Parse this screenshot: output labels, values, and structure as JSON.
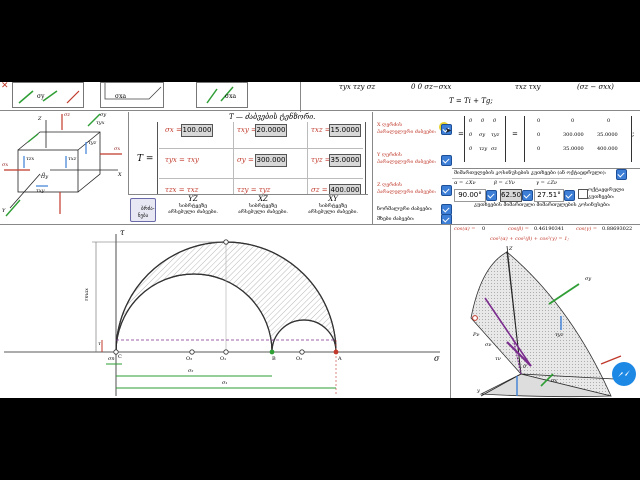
{
  "top_strip": {
    "tensor_row_1": "τyx  τzy  σz",
    "tensor_row_2": "0   0   σz−σxx",
    "tensor_row_3": "τxz  τxy",
    "tensor_row_4": "(σz − σxx)",
    "t_equation": "T = Ti + Tg;"
  },
  "cube_labels": {
    "sy_top": "σy",
    "sigma_bottom_left": "σx",
    "sigma_right": "σx",
    "z": "Z",
    "x": "X",
    "y": "Y",
    "tau_zx": "τzx",
    "tau_xz": "τxz",
    "tau_yz": "τyz",
    "tau_zy": "τzy",
    "tau_xy": "τxy",
    "tau_yx": "τyx",
    "sz": "σz",
    "o": "0"
  },
  "thumbnails": {
    "t1": "σy",
    "t2": "σxa",
    "t3": "σxa"
  },
  "tensor": {
    "title": "T — ძაბვების ტენზორი.",
    "t_symbol": "T =",
    "sx_label": "σx =",
    "sx_value": "100.000",
    "txy_label": "τxy =",
    "txy_value": "20.0000",
    "txz_label": "τxz =",
    "txz_value": "15.0000",
    "tyx_label": "τyx = τxy",
    "sy_label": "σy =",
    "sy_value": "300.000",
    "tyz_label": "τyz =",
    "tyz_value": "35.0000",
    "tzx_label": "τzx = τxz",
    "tzy_label": "τzy = τyz",
    "sz_label": "σz =",
    "sz_value": "400.000"
  },
  "planes": {
    "yz_title": "YZ",
    "yz_sub1": "სიბრტყეზე",
    "yz_sub2": "არსებული ძაბვები.",
    "xz_title": "XZ",
    "xz_sub1": "სიბრტყეზე",
    "xz_sub2": "არსებული ძაბვები.",
    "xy_title": "XY",
    "xy_sub1": "სიბრტყეზე",
    "xy_sub2": "არსებული ძაბვები.",
    "button_label": "ბრძა-\nნება"
  },
  "axis_options": {
    "x_label": "X ღერძის",
    "x_sub": "პარალელური ძაბვები:",
    "y_label": "Y ღერძის",
    "y_sub": "პარალელური ძაბვები:",
    "z_label": "Z ღერძის",
    "z_sub": "პარალელური ძაბვები:",
    "normal": "ნორმალური ძაბვები:",
    "shear": "მხები ძაბვები:"
  },
  "matrix": {
    "eq": "=",
    "r1": [
      "0",
      "0",
      "0"
    ],
    "r2": [
      "0",
      "σy",
      "τyz"
    ],
    "r3": [
      "0",
      "τzy",
      "σz"
    ],
    "m2_r1": [
      "0",
      "0",
      "0"
    ],
    "m2_r2": [
      "0",
      "300.000",
      "35.0000"
    ],
    "m2_r3": [
      "0",
      "35.0000",
      "400.000"
    ],
    "semicolon": ";"
  },
  "orientation": {
    "title": "მიმართულების კოსინუსების კუთხეები (ან ოქტაედრული):",
    "alpha_label": "α = ∠Xν",
    "beta_label": "β = ∠Yν",
    "gamma_label": "γ = ∠Zν",
    "alpha_value": "90.00°",
    "beta_value": "62.50",
    "gamma_value": "27.51°",
    "octa_label": "ოქტაედრული",
    "octa_sub": "კუთხეები:",
    "cos_title": "კუთხეების მიმართული მიმართულების კოსინუსები:",
    "cos_a_label": "cos(α) =",
    "cos_a_value": "0",
    "cos_b_label": "cos(β) =",
    "cos_b_value": "0.46190341",
    "cos_g_label": "cos(γ) =",
    "cos_g_value": "0.88693022",
    "identity": "cos²(α) + cos²(β) + cos²(γ) = 1;"
  },
  "mohr": {
    "tau_axis": "τ",
    "sigma_axis": "σ",
    "tau_max": "τmax",
    "tau_small": "τ",
    "points": [
      "C",
      "O₃",
      "O₁",
      "B",
      "O₂",
      "A"
    ],
    "sigma_n": "σn",
    "sigma_2": "σ₂",
    "sigma_1": "σ₁"
  },
  "view3d": {
    "z": "Z",
    "x": "X",
    "y": "y",
    "sigma_y": "σy",
    "sigma_x": "σx",
    "tau_yz": "τyz",
    "p": "Pν",
    "sigma_nu": "σν",
    "tau_nu": "τν",
    "o": "0'"
  },
  "colors": {
    "accent_blue": "#3d7fd6",
    "stress_red": "#c0392b",
    "green_arrow": "#2e9e35",
    "purple_vector": "#7b2d8e",
    "input_bg": "#d8d8d8"
  },
  "icons": {
    "close": "close-icon",
    "messenger": "messenger-icon",
    "cursor": "cursor-icon"
  }
}
